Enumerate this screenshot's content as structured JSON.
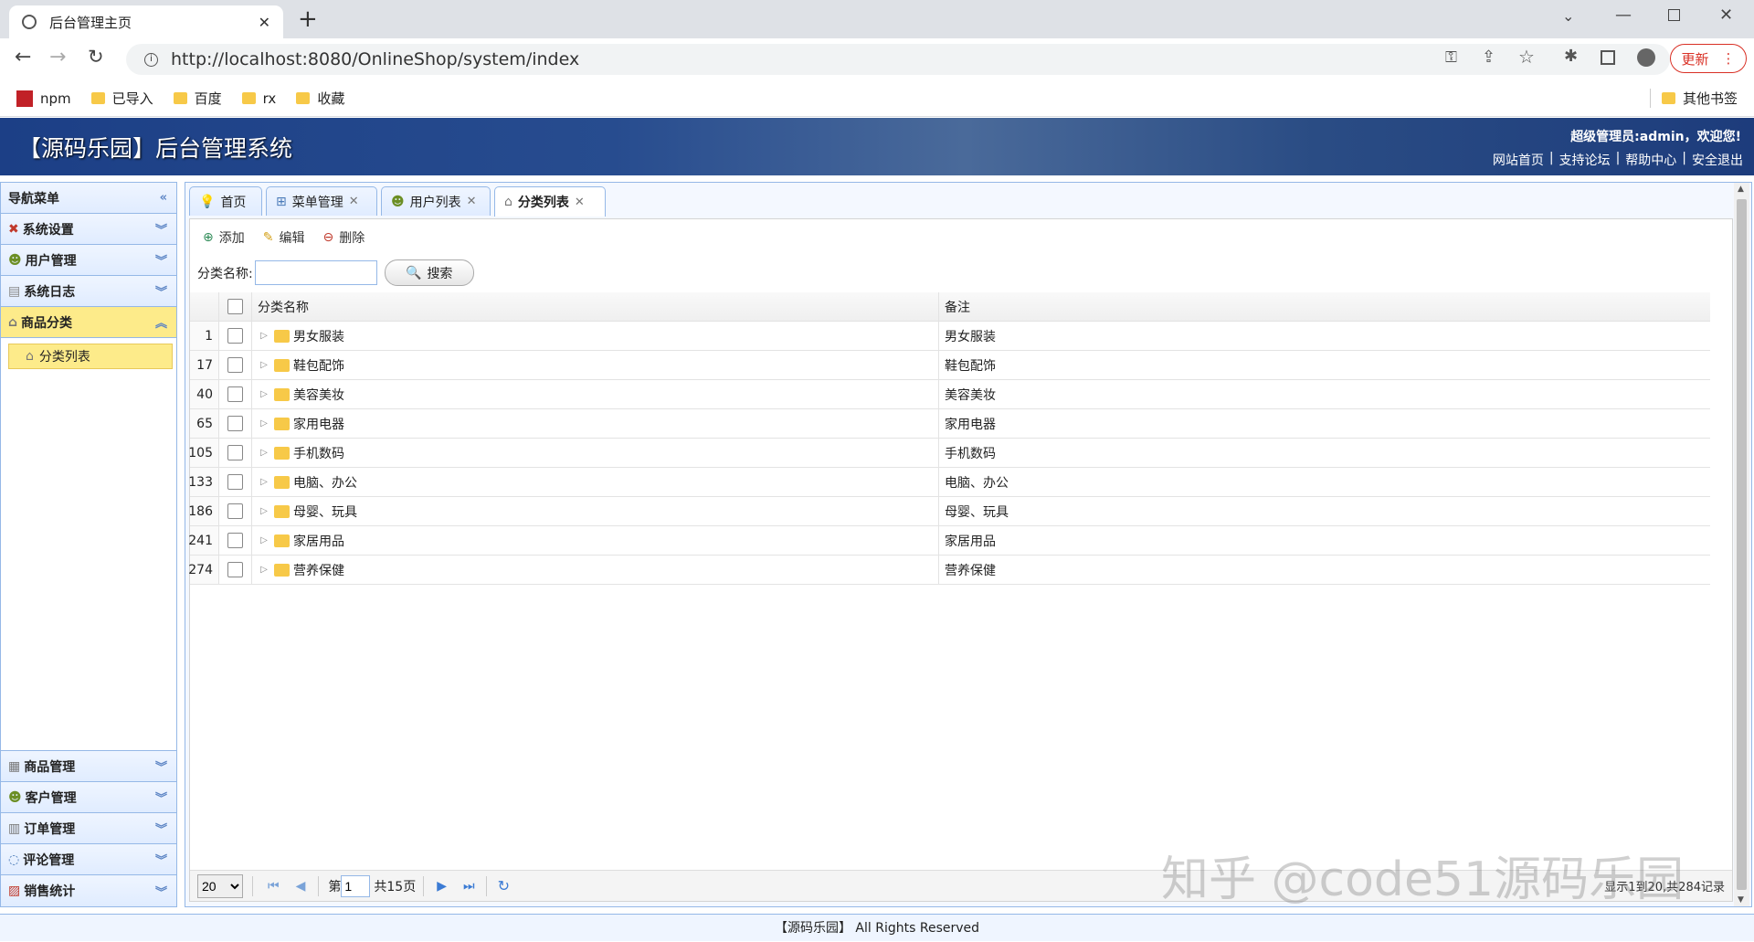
{
  "browser": {
    "tab_title": "后台管理主页",
    "url": "http://localhost:8080/OnlineShop/system/index",
    "update_label": "更新",
    "bookmarks": [
      "npm",
      "已导入",
      "百度",
      "rx",
      "收藏"
    ],
    "other_bookmarks": "其他书签"
  },
  "header": {
    "title": "【源码乐园】后台管理系统",
    "welcome": "超级管理员:admin，欢迎您!",
    "links": [
      "网站首页",
      "支持论坛",
      "帮助中心",
      "安全退出"
    ]
  },
  "sidebar": {
    "title": "导航菜单",
    "top_sections": [
      "系统设置",
      "用户管理",
      "系统日志",
      "商品分类"
    ],
    "active_item": "分类列表",
    "bottom_sections": [
      "商品管理",
      "客户管理",
      "订单管理",
      "评论管理",
      "销售统计"
    ]
  },
  "tabs": [
    "首页",
    "菜单管理",
    "用户列表",
    "分类列表"
  ],
  "toolbar": {
    "add": "添加",
    "edit": "编辑",
    "delete": "删除",
    "search_label": "分类名称:",
    "search_placeholder": "",
    "search_button": "搜索"
  },
  "grid": {
    "columns": [
      "分类名称",
      "备注"
    ],
    "rows": [
      {
        "id": "1",
        "name": "男女服装",
        "note": "男女服装"
      },
      {
        "id": "17",
        "name": "鞋包配饰",
        "note": "鞋包配饰"
      },
      {
        "id": "40",
        "name": "美容美妆",
        "note": "美容美妆"
      },
      {
        "id": "65",
        "name": "家用电器",
        "note": "家用电器"
      },
      {
        "id": "105",
        "name": "手机数码",
        "note": "手机数码"
      },
      {
        "id": "133",
        "name": "电脑、办公",
        "note": "电脑、办公"
      },
      {
        "id": "186",
        "name": "母婴、玩具",
        "note": "母婴、玩具"
      },
      {
        "id": "241",
        "name": "家居用品",
        "note": "家居用品"
      },
      {
        "id": "274",
        "name": "营养保健",
        "note": "营养保健"
      }
    ]
  },
  "pager": {
    "page_size": "20",
    "page_prefix": "第",
    "page_value": "1",
    "total_pages": "共15页",
    "display_info": "显示1到20,共284记录"
  },
  "watermark": "知乎 @code51源码乐园",
  "footer": "【源码乐园】 All Rights Reserved"
}
